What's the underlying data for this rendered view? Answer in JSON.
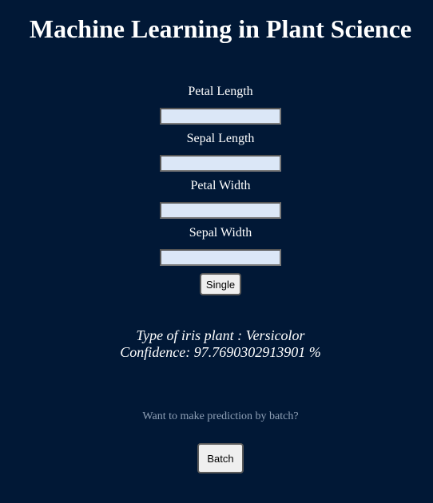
{
  "header": {
    "title": "Machine Learning in Plant Science"
  },
  "form": {
    "fields": [
      {
        "label": "Petal Length",
        "value": ""
      },
      {
        "label": "Sepal Length",
        "value": ""
      },
      {
        "label": "Petal Width",
        "value": ""
      },
      {
        "label": "Sepal Width",
        "value": ""
      }
    ],
    "single_button_label": "Single"
  },
  "result": {
    "type_line": "Type of iris plant : Versicolor",
    "confidence_line": "Confidence: 97.7690302913901 %"
  },
  "batch": {
    "prompt": "Want to make prediction by batch?",
    "button_label": "Batch"
  },
  "colors": {
    "background": "#011836",
    "input_fill": "#dbe7f7",
    "muted_text": "#8fa0b6"
  }
}
